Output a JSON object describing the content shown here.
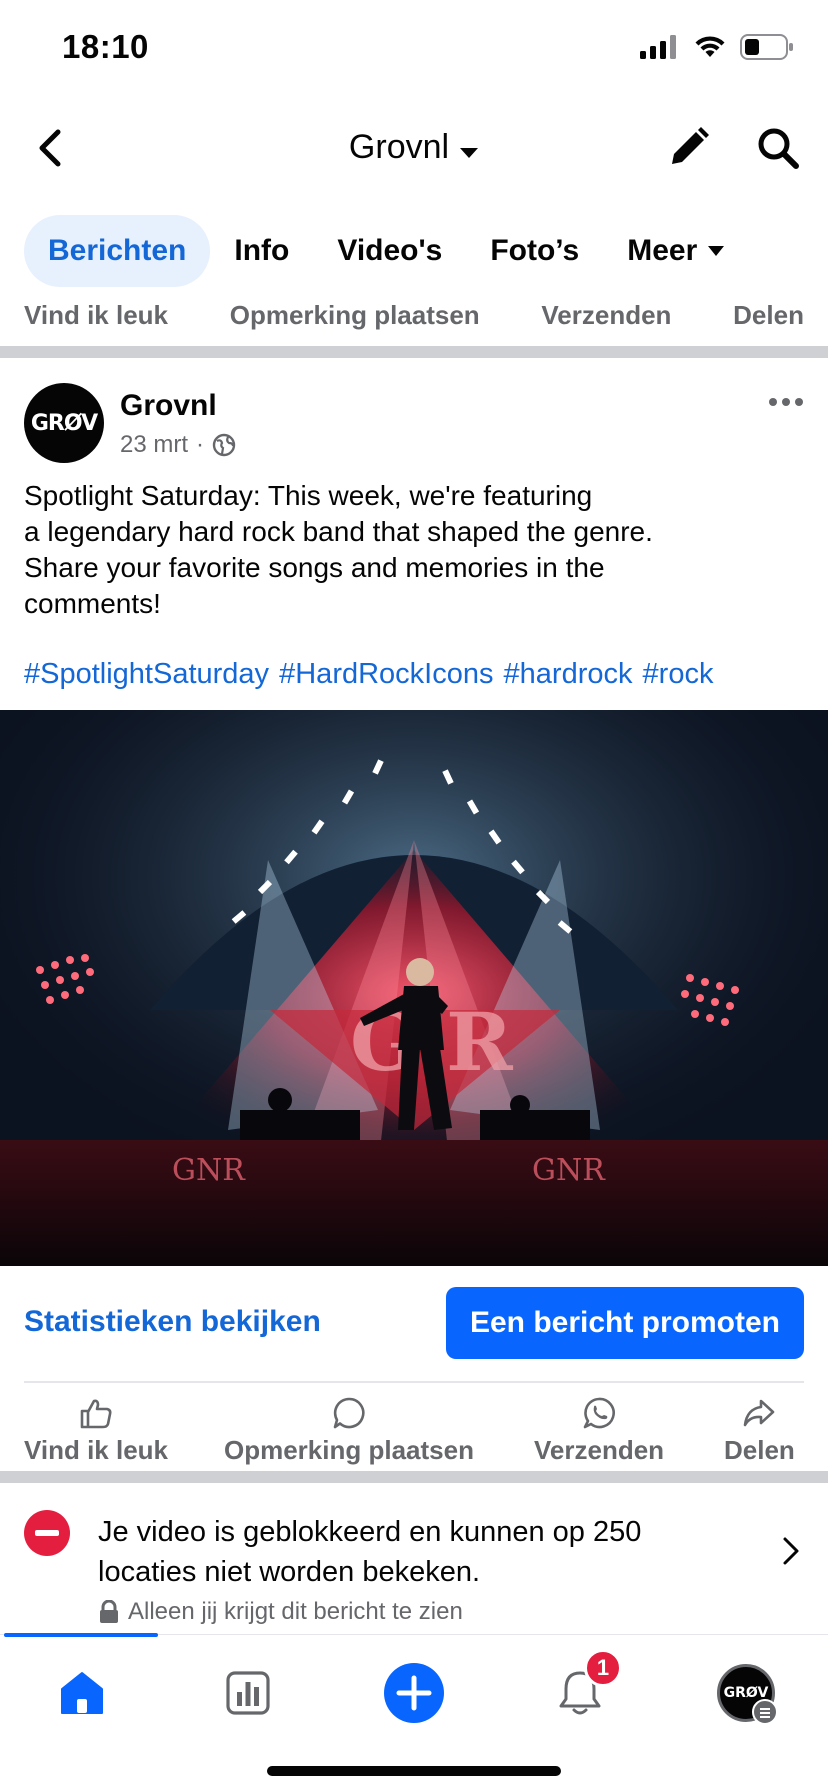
{
  "status_bar": {
    "time": "18:10"
  },
  "nav": {
    "title": "Grovnl"
  },
  "tabs": [
    {
      "label": "Berichten",
      "active": true
    },
    {
      "label": "Info",
      "active": false
    },
    {
      "label": "Video's",
      "active": false
    },
    {
      "label": "Foto’s",
      "active": false
    },
    {
      "label": "Meer",
      "active": false
    }
  ],
  "prev_post_actions": {
    "like": "Vind ik leuk",
    "comment": "Opmerking plaatsen",
    "send": "Verzenden",
    "share": "Delen"
  },
  "post": {
    "author": "Grovnl",
    "avatar_text": "GRØV",
    "date": "23 mrt",
    "separator": "·",
    "text_lines": [
      "Spotlight Saturday: This week, we're featuring",
      "a legendary hard rock band that shaped the genre.",
      "Share your favorite songs and memories in the",
      "comments!"
    ],
    "hashtags": "#SpotlightSaturday #HardRockIcons #hardrock #rock",
    "stage_text": {
      "logo": "G R",
      "left_sign": "GNR",
      "right_sign": "GNR"
    }
  },
  "promo": {
    "stats_link": "Statistieken bekijken",
    "promote_button": "Een bericht promoten"
  },
  "post_actions": {
    "like": "Vind ik leuk",
    "comment": "Opmerking plaatsen",
    "send": "Verzenden",
    "share": "Delen"
  },
  "notice": {
    "text": "Je video is geblokkeerd en kunnen op 250 locaties niet worden bekeken.",
    "private": "Alleen jij krijgt dit bericht te zien"
  },
  "tabbar": {
    "notifications_badge": "1",
    "profile_avatar_text": "GRØV"
  },
  "colors": {
    "accent": "#0866ff",
    "link": "#1467d6",
    "danger": "#e41e3f",
    "secondary_text": "#65676b"
  }
}
